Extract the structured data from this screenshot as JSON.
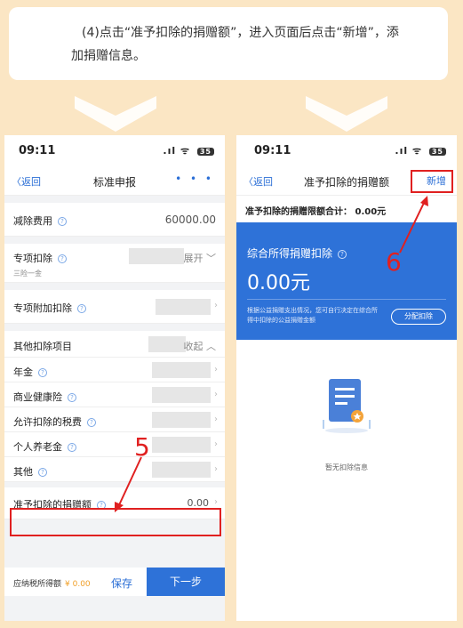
{
  "instruction": {
    "line1": "(4)点击“准予扣除的捐赠额”，进入页面后点击“新增”，添",
    "line2": "加捐赠信息。"
  },
  "left_phone": {
    "status": {
      "time": "09:11",
      "signal": ".ıl",
      "battery": "35"
    },
    "nav": {
      "back": "〈返回",
      "title": "标准申报",
      "more": "• • •"
    },
    "rows": {
      "jianchu": {
        "label": "减除费用",
        "value": "60000.00"
      },
      "zhuanxiang": {
        "label": "专项扣除",
        "sub": "三险一金",
        "value": "展开 ﹀"
      },
      "fujia": {
        "label": "专项附加扣除"
      },
      "qita_header": {
        "label": "其他扣除项目",
        "value": "收起 ︿"
      },
      "nianjin": {
        "label": "年金"
      },
      "jiankang": {
        "label": "商业健康险"
      },
      "shuifei": {
        "label": "允许扣除的税费"
      },
      "yanglao": {
        "label": "个人养老金"
      },
      "qita": {
        "label": "其他"
      },
      "juanzeng": {
        "label": "准予扣除的捐赠额",
        "value": "0.00"
      }
    },
    "bottom": {
      "label": "应纳税所得额",
      "amount": "¥ 0.00",
      "save": "保存",
      "next": "下一步"
    },
    "step_number": "5"
  },
  "right_phone": {
    "status": {
      "time": "09:11",
      "signal": ".ıl",
      "battery": "35"
    },
    "nav": {
      "back": "〈返回",
      "title": "准予扣除的捐赠额",
      "add": "新增"
    },
    "total": "准予扣除的捐赠限额合计：  0.00元",
    "card": {
      "title": "综合所得捐赠扣除",
      "amount": "0.00元",
      "note": "根据公益捐赠支出情况，您可自行决定在综合所得中扣除的公益捐赠金额",
      "button": "分配扣除"
    },
    "empty": "暂无扣除信息",
    "step_number": "6"
  },
  "colors": {
    "background": "#fbe6c4",
    "accent": "#2e72d8",
    "highlight": "#e02020"
  }
}
